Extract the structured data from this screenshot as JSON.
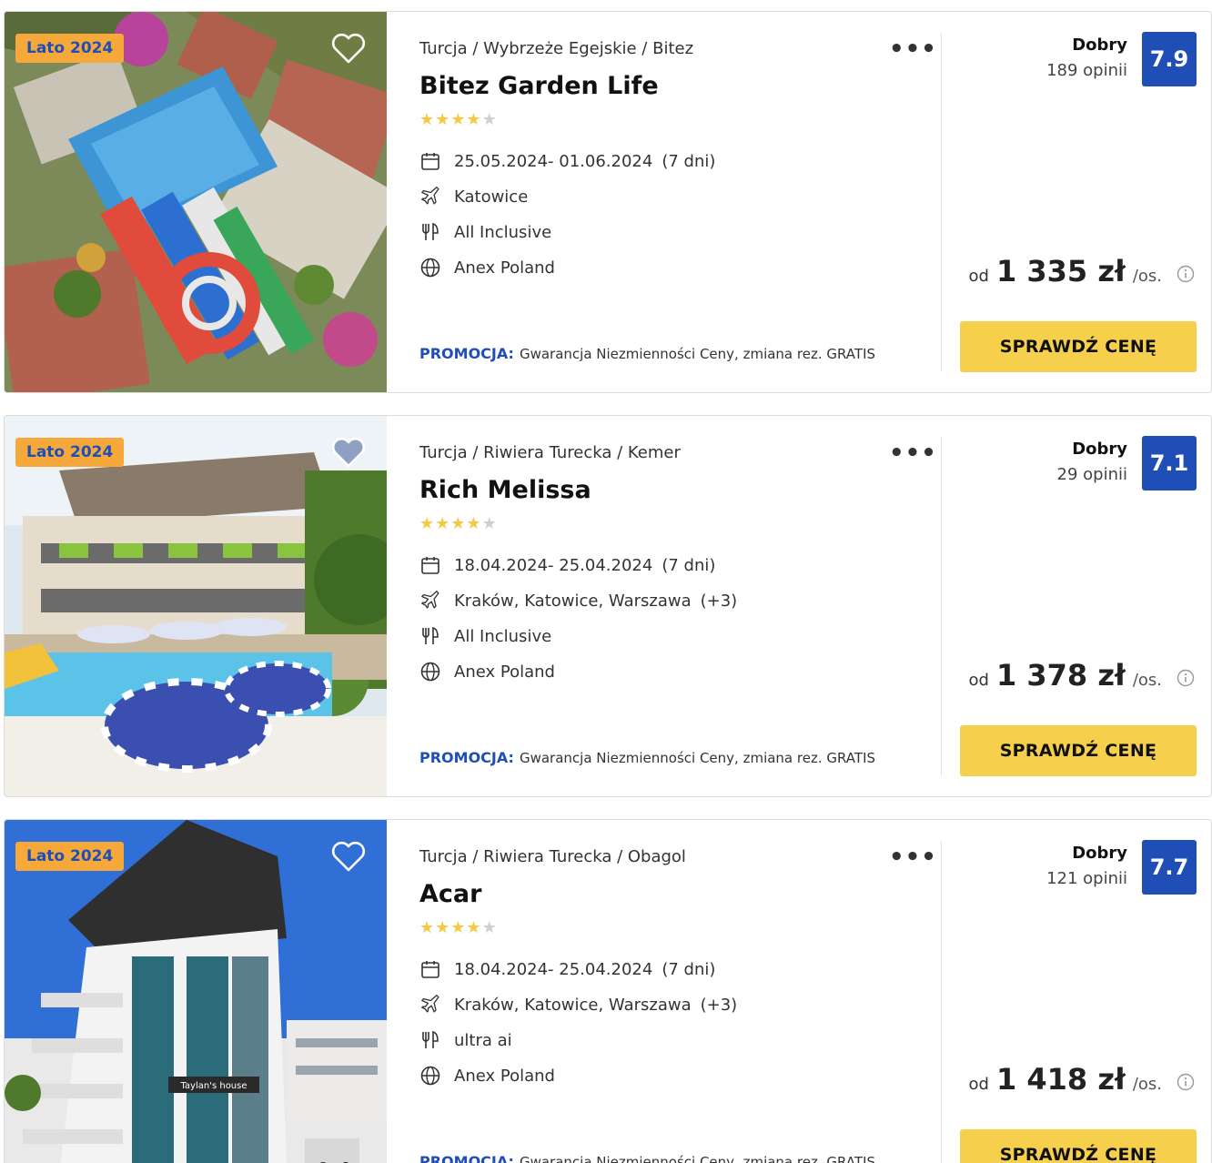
{
  "colors": {
    "accent_blue": "#1f4fb6",
    "badge_orange": "#f6a83b",
    "button_yellow": "#f6d04d",
    "star_yellow": "#f6c844"
  },
  "offers": [
    {
      "badge": "Lato 2024",
      "breadcrumb": "Turcja / Wybrzeże Egejskie / Bitez",
      "name": "Bitez Garden Life",
      "stars": 4,
      "dates": "25.05.2024- 01.06.2024",
      "duration": "(7 dni)",
      "departure": "Katowice",
      "departure_extra": "",
      "board": "All Inclusive",
      "operator": "Anex Poland",
      "promo_label": "PROMOCJA:",
      "promo_text": "Gwarancja Niezmienności Ceny, zmiana rez. GRATIS",
      "rating_word": "Dobry",
      "rating_count": "189 opinii",
      "score": "7.9",
      "price_prefix": "od",
      "price": "1 335 zł",
      "price_suffix": "/os.",
      "button": "SPRAWDŹ CENĘ",
      "favorite_icon": "heart-outline-icon"
    },
    {
      "badge": "Lato 2024",
      "breadcrumb": "Turcja / Riwiera Turecka / Kemer",
      "name": "Rich Melissa",
      "stars": 4,
      "dates": "18.04.2024- 25.04.2024",
      "duration": "(7 dni)",
      "departure": "Kraków, Katowice, Warszawa",
      "departure_extra": "(+3)",
      "board": "All Inclusive",
      "operator": "Anex Poland",
      "promo_label": "PROMOCJA:",
      "promo_text": "Gwarancja Niezmienności Ceny, zmiana rez. GRATIS",
      "rating_word": "Dobry",
      "rating_count": "29 opinii",
      "score": "7.1",
      "price_prefix": "od",
      "price": "1 378 zł",
      "price_suffix": "/os.",
      "button": "SPRAWDŹ CENĘ",
      "favorite_icon": "heart-outline-icon"
    },
    {
      "badge": "Lato 2024",
      "breadcrumb": "Turcja / Riwiera Turecka / Obagol",
      "name": "Acar",
      "stars": 4,
      "dates": "18.04.2024- 25.04.2024",
      "duration": "(7 dni)",
      "departure": "Kraków, Katowice, Warszawa",
      "departure_extra": "(+3)",
      "board": "ultra ai",
      "operator": "Anex Poland",
      "promo_label": "PROMOCJA:",
      "promo_text": "Gwarancja Niezmienności Ceny, zmiana rez. GRATIS",
      "rating_word": "Dobry",
      "rating_count": "121 opinii",
      "score": "7.7",
      "price_prefix": "od",
      "price": "1 418 zł",
      "price_suffix": "/os.",
      "button": "SPRAWDŹ CENĘ",
      "favorite_icon": "heart-outline-icon",
      "photo_sign": "Taylan's house"
    }
  ]
}
